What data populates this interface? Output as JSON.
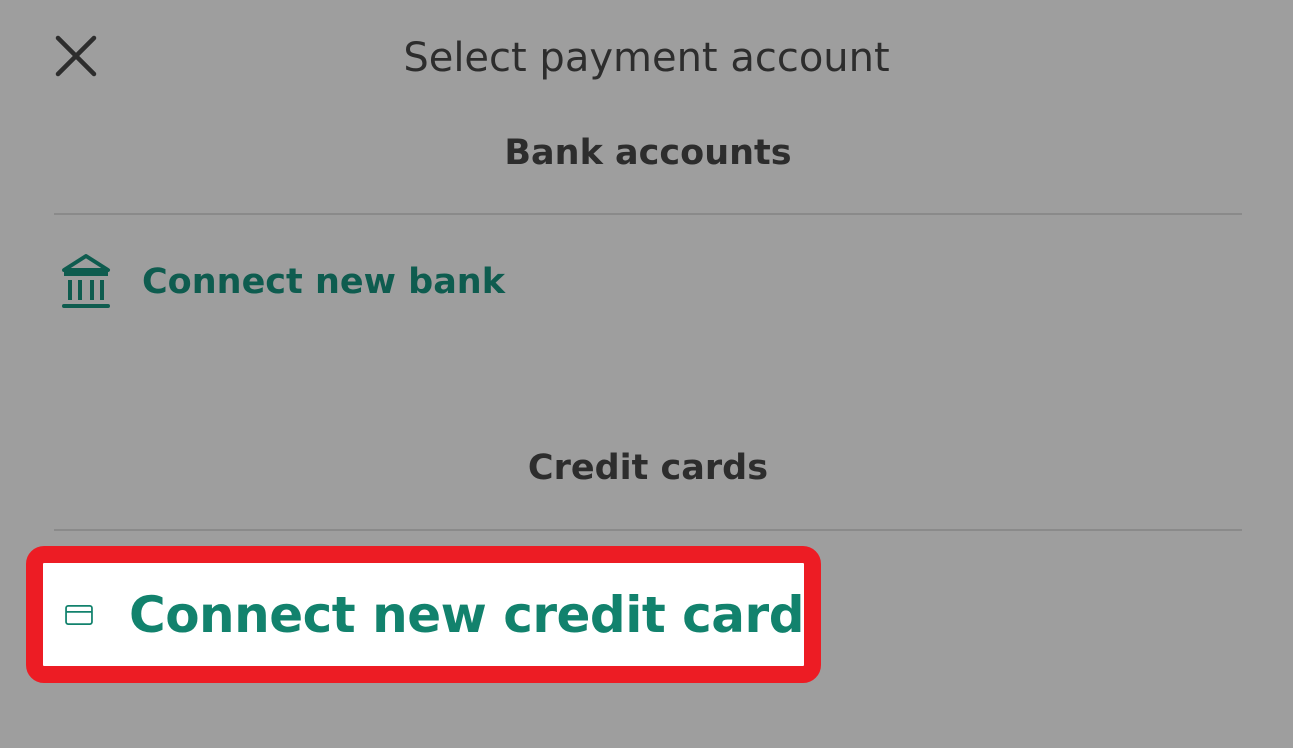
{
  "header": {
    "title": "Select payment account",
    "close_icon": "close-icon"
  },
  "bank_section": {
    "heading": "Bank accounts",
    "connect_label": "Connect new bank",
    "icon": "bank-icon"
  },
  "card_section": {
    "heading": "Credit cards",
    "connect_label": "Connect new credit card",
    "icon": "credit-card-icon"
  },
  "colors": {
    "background": "#9e9e9e",
    "text": "#2d2d2d",
    "bank_link": "#0e5c4f",
    "card_link": "#12826d",
    "highlight": "#ed1c24"
  }
}
